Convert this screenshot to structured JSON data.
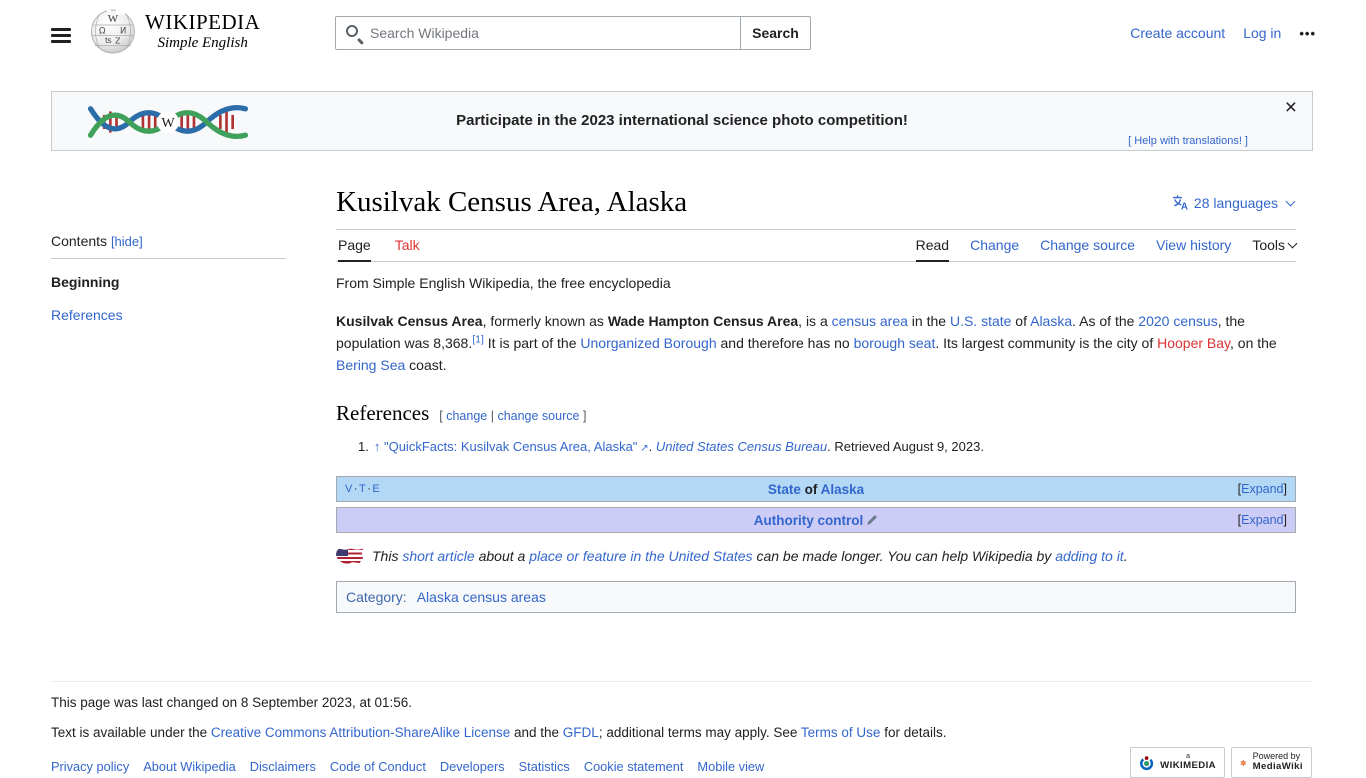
{
  "colors": {
    "link": "#3366cc",
    "red_link": "#dd3333",
    "text": "#202122",
    "navbox_state_bg": "#b3d8f6",
    "navbox_authority_bg": "#ccccf6"
  },
  "header": {
    "wordmark": "WIKIPEDIA",
    "tagline": "Simple English",
    "search": {
      "placeholder": "Search Wikipedia",
      "button": "Search"
    },
    "links": {
      "create_account": "Create account",
      "log_in": "Log in",
      "more": "•••"
    }
  },
  "banner": {
    "message": "Participate in the 2023 international science photo competition!",
    "help_link": "[ Help with translations! ]",
    "close": "×"
  },
  "toc": {
    "title": "Contents",
    "hide": "[hide]",
    "items": [
      {
        "label": "Beginning",
        "active": true
      },
      {
        "label": "References",
        "active": false
      }
    ]
  },
  "article": {
    "title": "Kusilvak Census Area, Alaska",
    "languages_label": "28 languages",
    "tabs": {
      "page": "Page",
      "talk": "Talk",
      "read": "Read",
      "change": "Change",
      "change_source": "Change source",
      "view_history": "View history",
      "tools": "Tools"
    },
    "subtitle": "From Simple English Wikipedia, the free encyclopedia",
    "paragraph": [
      {
        "t": "Kusilvak Census Area",
        "c": "b"
      },
      {
        "t": ", formerly known as "
      },
      {
        "t": "Wade Hampton Census Area",
        "c": "b"
      },
      {
        "t": ", is a "
      },
      {
        "t": "census area",
        "c": "lk",
        "n": "link-census-area"
      },
      {
        "t": " in the "
      },
      {
        "t": "U.S. state",
        "c": "lk",
        "n": "link-us-state"
      },
      {
        "t": " of "
      },
      {
        "t": "Alaska",
        "c": "lk",
        "n": "link-alaska"
      },
      {
        "t": ". As of the "
      },
      {
        "t": "2020 census",
        "c": "lk",
        "n": "link-2020-census"
      },
      {
        "t": ", the population was 8,368."
      },
      {
        "t": "[1]",
        "c": "lk sup",
        "n": "ref-1-superscript"
      },
      {
        "t": " It is part of the "
      },
      {
        "t": "Unorganized Borough",
        "c": "lk",
        "n": "link-unorganized-borough"
      },
      {
        "t": " and therefore has no "
      },
      {
        "t": "borough seat",
        "c": "lk",
        "n": "link-borough-seat"
      },
      {
        "t": ". Its largest community is the city of "
      },
      {
        "t": "Hooper Bay",
        "c": "rd",
        "n": "redlink-hooper-bay"
      },
      {
        "t": ", on the "
      },
      {
        "t": "Bering Sea",
        "c": "lk",
        "n": "link-bering-sea"
      },
      {
        "t": " coast."
      }
    ],
    "references": {
      "heading": "References",
      "edit_links": [
        {
          "t": "[ ",
          "c": "mt"
        },
        {
          "t": "change",
          "c": "lk",
          "n": "link-change"
        },
        {
          "t": " | ",
          "c": "mt"
        },
        {
          "t": "change source",
          "c": "lk",
          "n": "link-change-source"
        },
        {
          "t": " ]",
          "c": "mt"
        }
      ],
      "items": [
        {
          "number": "1.",
          "segments": [
            {
              "t": "↑ ",
              "c": "lk",
              "n": "ref-backlink"
            },
            {
              "t": "\"QuickFacts: Kusilvak Census Area, Alaska\"",
              "c": "lk",
              "n": "link-quickfacts"
            },
            {
              "t": " ↗",
              "c": "lk ext",
              "n": "external-link-icon"
            },
            {
              "t": ". "
            },
            {
              "t": "United States Census Bureau",
              "c": "lk i",
              "n": "link-census-bureau"
            },
            {
              "t": ". Retrieved August 9, 2023."
            }
          ]
        }
      ]
    },
    "navboxes": [
      {
        "vte": [
          "V",
          "T",
          "E"
        ],
        "vte_sep": "·",
        "title_segments": [
          {
            "t": "State",
            "c": "lk b",
            "n": "link-state"
          },
          {
            "t": " of ",
            "c": "b"
          },
          {
            "t": "Alaska",
            "c": "lk b",
            "n": "link-alaska-navbox"
          }
        ],
        "expand_segments": [
          {
            "t": "[",
            "c": ""
          },
          {
            "t": "Expand",
            "c": "lk",
            "n": "expand-link"
          },
          {
            "t": "]",
            "c": ""
          }
        ]
      },
      {
        "title_segments": [
          {
            "t": "Authority control",
            "c": "lk b",
            "n": "link-authority-control"
          }
        ],
        "expand_segments": [
          {
            "t": "[",
            "c": ""
          },
          {
            "t": "Expand",
            "c": "lk",
            "n": "expand-link"
          },
          {
            "t": "]",
            "c": ""
          }
        ]
      }
    ],
    "stub_segments": [
      {
        "t": "This ",
        "c": "i"
      },
      {
        "t": "short article",
        "c": "lk i",
        "n": "link-short-article"
      },
      {
        "t": " about a ",
        "c": "i"
      },
      {
        "t": "place or feature in the United States",
        "c": "lk i",
        "n": "link-place-or-feature"
      },
      {
        "t": " can be made longer. You can help Wikipedia by ",
        "c": "i"
      },
      {
        "t": "adding to it",
        "c": "lk i",
        "n": "link-adding-to-it"
      },
      {
        "t": ".",
        "c": "i"
      }
    ],
    "category": {
      "label": "Category:",
      "items": [
        "Alaska census areas"
      ]
    }
  },
  "footer": {
    "last_changed": "This page was last changed on 8 September 2023, at 01:56.",
    "license_segments": [
      {
        "t": "Text is available under the "
      },
      {
        "t": "Creative Commons Attribution-ShareAlike License",
        "c": "lk",
        "n": "link-cc-license"
      },
      {
        "t": " and the "
      },
      {
        "t": "GFDL",
        "c": "lk",
        "n": "link-gfdl"
      },
      {
        "t": "; additional terms may apply. See "
      },
      {
        "t": "Terms of Use",
        "c": "lk",
        "n": "link-terms-of-use"
      },
      {
        "t": " for details."
      }
    ],
    "links": [
      "Privacy policy",
      "About Wikipedia",
      "Disclaimers",
      "Code of Conduct",
      "Developers",
      "Statistics",
      "Cookie statement",
      "Mobile view"
    ],
    "badges": {
      "wikimedia_small": "a",
      "wikimedia": "WIKIMEDIA",
      "powered_by": "Powered by",
      "mediawiki": "MediaWiki"
    }
  }
}
